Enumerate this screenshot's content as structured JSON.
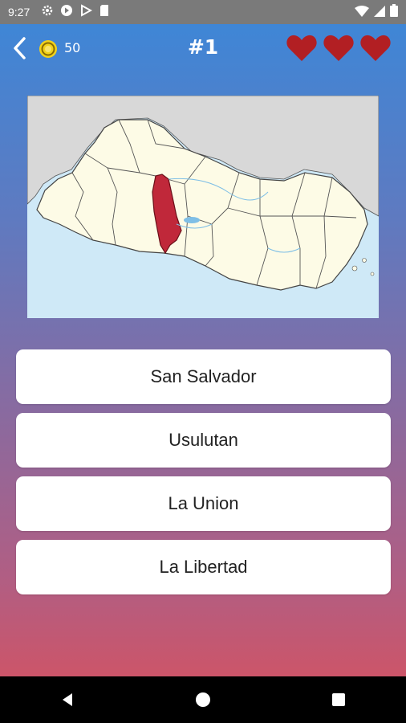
{
  "status_bar": {
    "time": "9:27"
  },
  "header": {
    "coins": "50",
    "question_number": "#1",
    "lives": 3
  },
  "map": {
    "highlighted_region_color": "#c0283a",
    "land_color": "#fdfbe6",
    "neighbor_color": "#d8d8d8",
    "sea_color": "#cfe9f7"
  },
  "answers": [
    {
      "label": "San Salvador"
    },
    {
      "label": "Usulutan"
    },
    {
      "label": "La Union"
    },
    {
      "label": "La Libertad"
    }
  ],
  "colors": {
    "heart": "#b21f23",
    "coin": "#f2d21b"
  }
}
